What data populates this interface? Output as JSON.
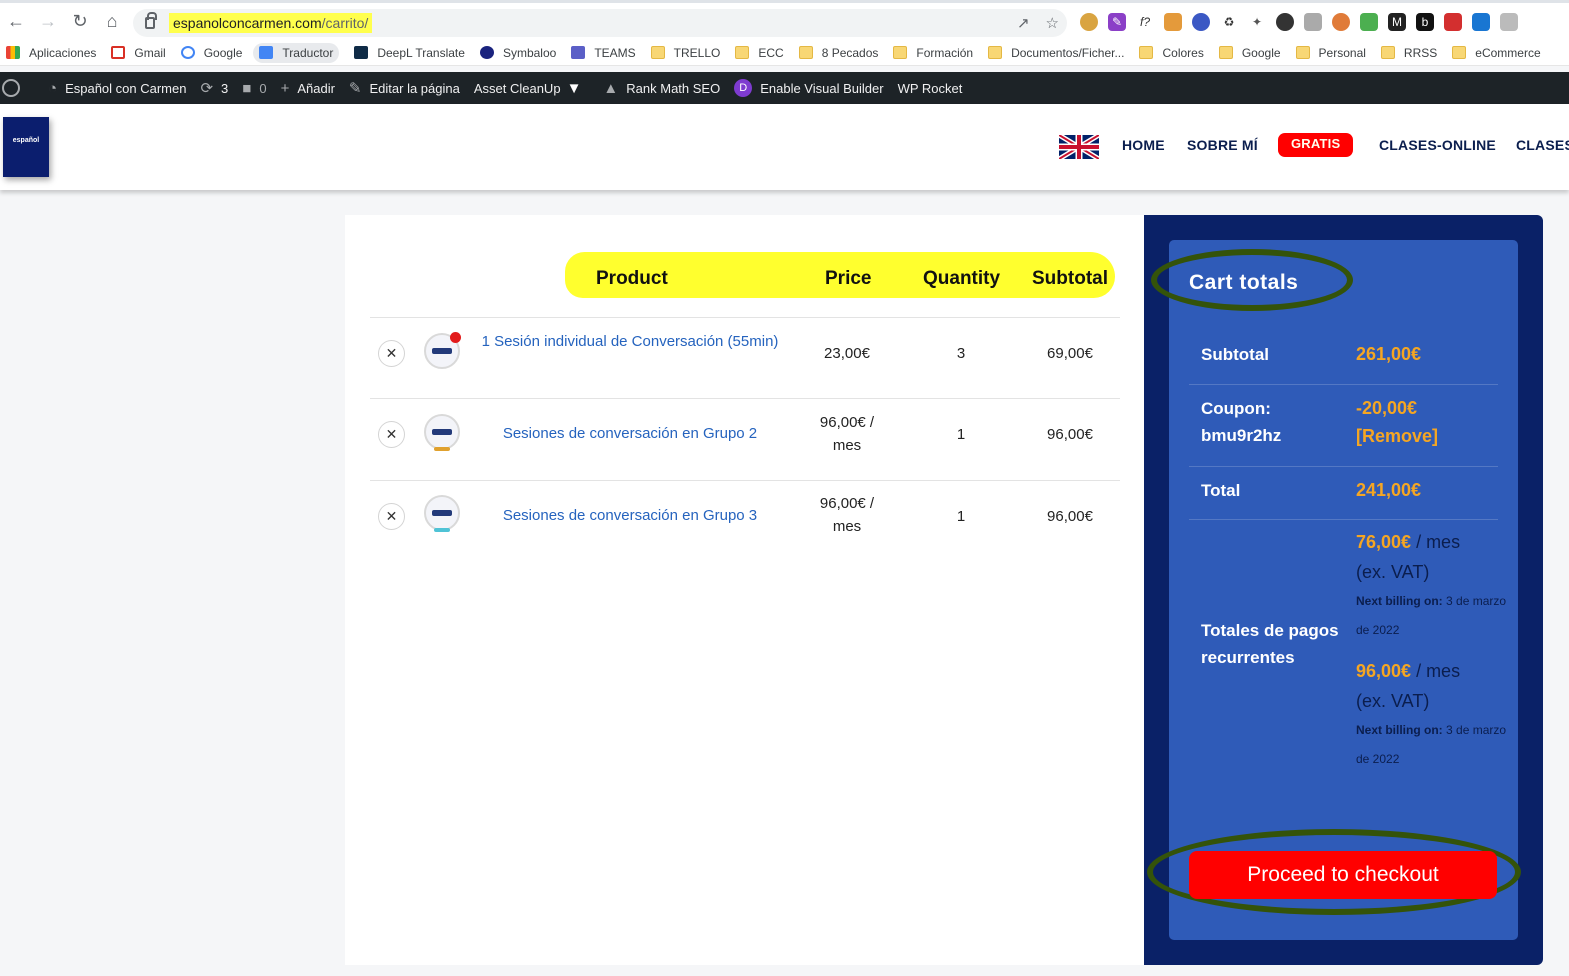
{
  "browser": {
    "url_domain": "espanolconcarmen.com",
    "url_path": "/carrito/"
  },
  "bookmarks": [
    {
      "label": "Aplicaciones",
      "icon": "apps-grid-icon"
    },
    {
      "label": "Gmail",
      "icon": "gmail-icon"
    },
    {
      "label": "Google",
      "icon": "google-icon"
    },
    {
      "label": "Traductor",
      "icon": "translate-icon"
    },
    {
      "label": "DeepL Translate",
      "icon": "deepl-icon"
    },
    {
      "label": "Symbaloo",
      "icon": "symbaloo-icon"
    },
    {
      "label": "TEAMS",
      "icon": "teams-icon"
    },
    {
      "label": "TRELLO",
      "icon": "folder-icon"
    },
    {
      "label": "ECC",
      "icon": "folder-icon"
    },
    {
      "label": "8 Pecados",
      "icon": "folder-icon"
    },
    {
      "label": "Formación",
      "icon": "folder-icon"
    },
    {
      "label": "Documentos/Ficher...",
      "icon": "folder-icon"
    },
    {
      "label": "Colores",
      "icon": "folder-icon"
    },
    {
      "label": "Google",
      "icon": "folder-icon"
    },
    {
      "label": "Personal",
      "icon": "folder-icon"
    },
    {
      "label": "RRSS",
      "icon": "folder-icon"
    },
    {
      "label": "eCommerce",
      "icon": "folder-icon"
    }
  ],
  "wpbar": {
    "site_name": "Español con Carmen",
    "updates_count": "3",
    "comments_count": "0",
    "add_label": "Añadir",
    "edit_label": "Editar la página",
    "asset_cleanup": "Asset CleanUp",
    "rank_math": "Rank Math SEO",
    "visual_builder": "Enable Visual Builder",
    "wp_rocket": "WP Rocket"
  },
  "header": {
    "logo_text": "español",
    "menu": {
      "home": "HOME",
      "sobre": "SOBRE MÍ",
      "gratis": "GRATIS",
      "clases_online": "CLASES-ONLINE",
      "clases": "CLASES"
    }
  },
  "cart": {
    "headers": {
      "product": "Product",
      "price": "Price",
      "quantity": "Quantity",
      "subtotal": "Subtotal"
    },
    "rows": [
      {
        "name": "1 Sesión individual de Conversación (55min)",
        "price": "23,00€",
        "price_period": "",
        "quantity": "3",
        "subtotal": "69,00€"
      },
      {
        "name": "Sesiones de conversación en Grupo 2",
        "price": "96,00€ /",
        "price_period": "mes",
        "quantity": "1",
        "subtotal": "96,00€"
      },
      {
        "name": "Sesiones de conversación en Grupo 3",
        "price": "96,00€ /",
        "price_period": "mes",
        "quantity": "1",
        "subtotal": "96,00€"
      }
    ]
  },
  "totals": {
    "title": "Cart totals",
    "subtotal_label": "Subtotal",
    "subtotal_value": "261,00€",
    "coupon_label": "Coupon:",
    "coupon_code": "bmu9r2hz",
    "coupon_value": "-20,00€",
    "coupon_remove": "[Remove]",
    "total_label": "Total",
    "total_value": "241,00€",
    "recurring_label": "Totales de pagos recurrentes",
    "recurring": [
      {
        "amount": "76,00€",
        "period": " / mes",
        "vat": "(ex. VAT)",
        "billing_label": "Next billing on:",
        "billing_date": " 3 de marzo de 2022"
      },
      {
        "amount": "96,00€",
        "period": " / mes",
        "vat": "(ex. VAT)",
        "billing_label": "Next billing on:",
        "billing_date": " 3 de marzo de 2022"
      }
    ],
    "checkout_label": "Proceed to checkout"
  },
  "colors": {
    "totals_bg": "#0a2167",
    "totals_inner": "#2f5bb8",
    "accent_orange": "#f5a623",
    "checkout_red": "#ff0000",
    "link_blue": "#2563be",
    "highlight_yellow": "#ffff2e",
    "annotation_green": "#34530a"
  }
}
